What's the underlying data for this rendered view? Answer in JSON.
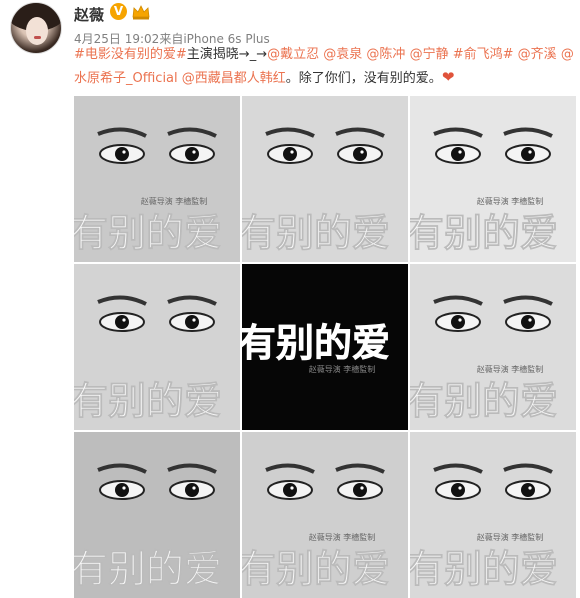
{
  "post": {
    "username": "赵薇",
    "verified_badge": "V",
    "meta_date": "4月25日",
    "meta_time": "19:02",
    "meta_source_prefix": "来自",
    "meta_source": "iPhone 6s Plus",
    "text_segments": [
      {
        "type": "link",
        "text": "#电影没有别的爱#"
      },
      {
        "type": "text",
        "text": "主演揭晓→_→"
      },
      {
        "type": "link",
        "text": "@戴立忍"
      },
      {
        "type": "text",
        "text": " "
      },
      {
        "type": "link",
        "text": "@袁泉"
      },
      {
        "type": "text",
        "text": " "
      },
      {
        "type": "link",
        "text": "@陈冲"
      },
      {
        "type": "text",
        "text": " "
      },
      {
        "type": "link",
        "text": "@宁静"
      },
      {
        "type": "text",
        "text": " "
      },
      {
        "type": "link",
        "text": "#俞飞鸿#"
      },
      {
        "type": "text",
        "text": " "
      },
      {
        "type": "link",
        "text": "@齐溪"
      },
      {
        "type": "text",
        "text": " "
      },
      {
        "type": "link",
        "text": "@水原希子_Official"
      },
      {
        "type": "text",
        "text": " "
      },
      {
        "type": "link",
        "text": "@西藏昌都人韩红"
      },
      {
        "type": "text",
        "text": "。除了你们，没有别的爱。"
      }
    ],
    "heart_icon": "heart-emoji"
  },
  "posters": {
    "credit": "赵薇导演 李檣監制",
    "title_fragment": "有别的爱",
    "cells": [
      {
        "tone": "#c9c9c9",
        "dark": false,
        "credit": true
      },
      {
        "tone": "#d8d8d8",
        "dark": false,
        "credit": false
      },
      {
        "tone": "#e6e6e6",
        "dark": false,
        "credit": true
      },
      {
        "tone": "#d3d3d3",
        "dark": false,
        "credit": false
      },
      {
        "tone": "#060606",
        "dark": true,
        "credit": true
      },
      {
        "tone": "#dcdcdc",
        "dark": false,
        "credit": true
      },
      {
        "tone": "#bdbdbd",
        "dark": false,
        "credit": false
      },
      {
        "tone": "#cfcfcf",
        "dark": false,
        "credit": true
      },
      {
        "tone": "#d9d9d9",
        "dark": false,
        "credit": true
      }
    ]
  }
}
